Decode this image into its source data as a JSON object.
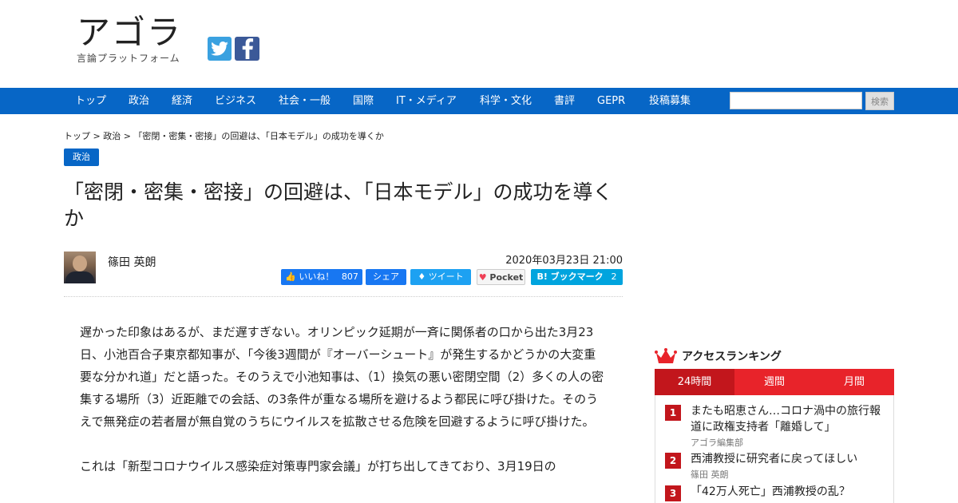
{
  "header": {
    "logo_main": "アゴラ",
    "logo_sub": "言論プラットフォーム",
    "icons": [
      "twitter-icon",
      "facebook-icon"
    ]
  },
  "nav": {
    "items": [
      "トップ",
      "政治",
      "経済",
      "ビジネス",
      "社会・一般",
      "国際",
      "IT・メディア",
      "科学・文化",
      "書評",
      "GEPR",
      "投稿募集"
    ],
    "search_value": "",
    "search_button": "検索"
  },
  "breadcrumb": "トップ > 政治 > 「密閉・密集・密接」の回避は、「日本モデル」の成功を導くか",
  "article": {
    "category": "政治",
    "title": "「密閉・密集・密接」の回避は、「日本モデル」の成功を導くか",
    "author": "篠田 英朗",
    "date": "2020年03月23日 21:00",
    "share": {
      "like_label": "いいね！",
      "like_count": "807",
      "share_label": "シェア",
      "tweet_label": "ツイート",
      "pocket_label": "Pocket",
      "hatena_label": "B! ブックマーク",
      "hatena_count": "2"
    },
    "paragraphs": [
      "遅かった印象はあるが、まだ遅すぎない。オリンピック延期が一斉に関係者の口から出た3月23日、小池百合子東京都知事が、「今後3週間が『オーバーシュート』が発生するかどうかの大変重要な分かれ道」だと語った。そのうえで小池知事は、（1）換気の悪い密閉空間（2）多くの人の密集する場所（3）近距離での会話、の3条件が重なる場所を避けるよう都民に呼び掛けた。そのうえで無発症の若者層が無自覚のうちにウイルスを拡散させる危険を回避するように呼び掛けた。",
      "これは「新型コロナウイルス感染症対策専門家会議」が打ち出してきており、3月19日の"
    ]
  },
  "ranking": {
    "heading": "アクセスランキング",
    "tabs": [
      "24時間",
      "週間",
      "月間"
    ],
    "active_tab": "24時間",
    "items": [
      {
        "rank": "1",
        "title": "またも昭恵さん…コロナ渦中の旅行報道に政権支持者「離婚して」",
        "author": "アゴラ編集部"
      },
      {
        "rank": "2",
        "title": "西浦教授に研究者に戻ってほしい",
        "author": "篠田 英朗"
      },
      {
        "rank": "3",
        "title": "「42万人死亡」西浦教授の乱？",
        "author": ""
      }
    ]
  },
  "colors": {
    "nav_blue": "#0766c6",
    "ranking_red": "#e8232a",
    "ranking_dark_red": "#c2161c"
  }
}
